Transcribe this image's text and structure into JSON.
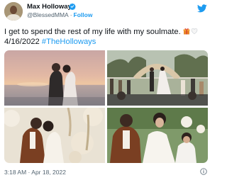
{
  "author": {
    "display_name": "Max Holloway",
    "handle": "@BlessedMMA",
    "separator": "·",
    "follow_label": "Follow",
    "verified_color": "#1d9bf0"
  },
  "tweet": {
    "text": "I get to spend the rest of my life with my soulmate.",
    "date": "4/16/2022",
    "hashtag": "#TheHolloways",
    "emojis": [
      "gift-emoji",
      "white-heart-emoji"
    ]
  },
  "media": {
    "photos": [
      "sunset-beach-kiss-photo",
      "garden-ceremony-photo",
      "floral-arch-kiss-photo",
      "couple-with-child-photo"
    ]
  },
  "footer": {
    "timestamp": "3:18 AM · Apr 18, 2022"
  },
  "colors": {
    "link": "#1d9bf0",
    "text": "#0f1419",
    "secondary": "#536471"
  }
}
